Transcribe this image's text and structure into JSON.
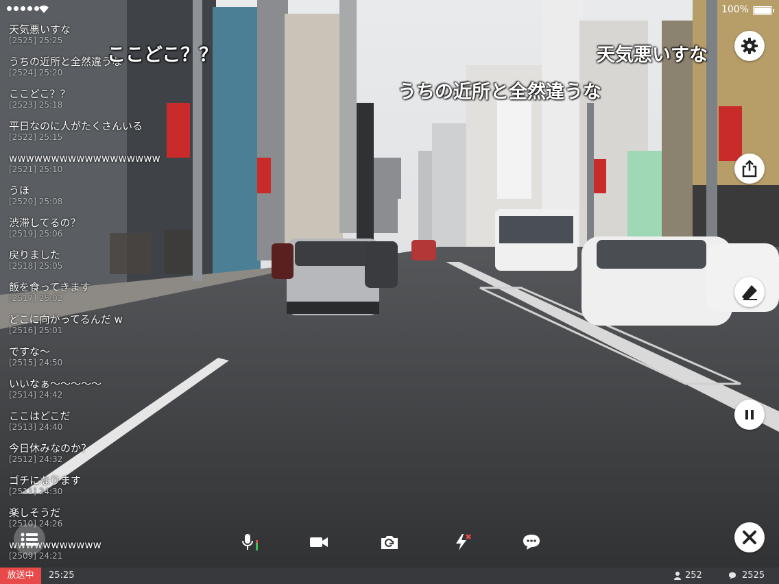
{
  "status_bar": {
    "battery": "100%",
    "battery_level": 1.0
  },
  "comments": [
    {
      "text": "天気悪いすな",
      "meta": "[2525] 25:25"
    },
    {
      "text": "うちの近所と全然違うな",
      "meta": "[2524] 25:20"
    },
    {
      "text": "ここどこ？？",
      "meta": "[2523] 25:18"
    },
    {
      "text": "平日なのに人がたくさんいる",
      "meta": "[2522] 25:15"
    },
    {
      "text": "wwwwwwwwwwwwwwwwww",
      "meta": "[2521] 25:10"
    },
    {
      "text": "うほ",
      "meta": "[2520] 25:08"
    },
    {
      "text": "渋滞してるの？",
      "meta": "[2519] 25:06"
    },
    {
      "text": "戻りました",
      "meta": "[2518] 25:05"
    },
    {
      "text": "飯を食ってきます",
      "meta": "[2517] 25:02"
    },
    {
      "text": "どこに向かってるんだ w",
      "meta": "[2516] 25:01"
    },
    {
      "text": "ですな～",
      "meta": "[2515] 24:50"
    },
    {
      "text": "いいなぁ～～～～～",
      "meta": "[2514] 24:42"
    },
    {
      "text": "ここはどこだ",
      "meta": "[2513] 24:40"
    },
    {
      "text": "今日休みなのか？",
      "meta": "[2512] 24:32"
    },
    {
      "text": "ゴチになります",
      "meta": "[2511] 24:30"
    },
    {
      "text": "楽しそうだ",
      "meta": "[2510] 24:26"
    },
    {
      "text": "wwwwwwwwwww",
      "meta": "[2509] 24:21"
    }
  ],
  "overlay": {
    "flow1": "ここどこ？？",
    "flow2": "天気悪いすな",
    "flow3": "うちの近所と全然違うな"
  },
  "icons": {
    "settings": "gear-icon",
    "share": "share-icon",
    "eraser": "eraser-icon",
    "pause": "pause-icon",
    "close": "close-icon",
    "mic": "microphone-icon",
    "video": "video-camera-icon",
    "camera_switch": "camera-switch-icon",
    "flash": "flash-off-icon",
    "chat": "chat-bubble-icon",
    "list": "list-icon"
  },
  "bottom_bar": {
    "live_label": "放送中",
    "elapsed": "25:25",
    "viewers": "252",
    "comment_count": "2525"
  },
  "colors": {
    "live": "#e84a4a",
    "bar": "#37393c",
    "meta": "#b4b7bb"
  }
}
